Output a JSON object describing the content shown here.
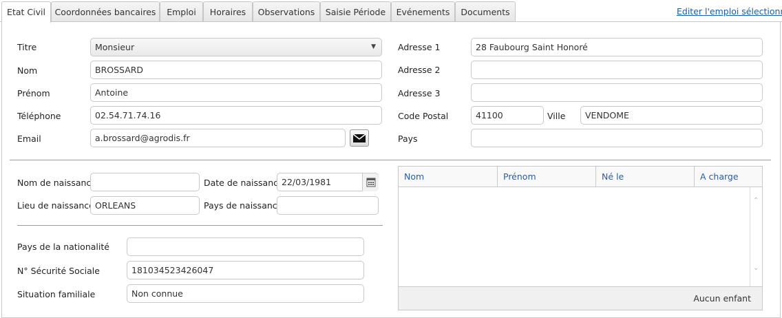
{
  "tabs": [
    {
      "label": "Etat Civil",
      "active": true
    },
    {
      "label": "Coordonnées bancaires",
      "active": false
    },
    {
      "label": "Emploi",
      "active": false
    },
    {
      "label": "Horaires",
      "active": false
    },
    {
      "label": "Observations",
      "active": false
    },
    {
      "label": "Saisie Période",
      "active": false
    },
    {
      "label": "Evénements",
      "active": false
    },
    {
      "label": "Documents",
      "active": false
    }
  ],
  "edit_link": "Editer l'emploi sélectionné",
  "identity": {
    "titre_label": "Titre",
    "titre_value": "Monsieur",
    "nom_label": "Nom",
    "nom_value": "BROSSARD",
    "prenom_label": "Prénom",
    "prenom_value": "Antoine",
    "telephone_label": "Téléphone",
    "telephone_value": "02.54.71.74.16",
    "email_label": "Email",
    "email_value": "a.brossard@agrodis.fr"
  },
  "address": {
    "adresse1_label": "Adresse 1",
    "adresse1_value": "28 Faubourg Saint Honoré",
    "adresse2_label": "Adresse 2",
    "adresse2_value": "",
    "adresse3_label": "Adresse 3",
    "adresse3_value": "",
    "code_postal_label": "Code Postal",
    "code_postal_value": "41100",
    "ville_label": "Ville",
    "ville_value": "VENDOME",
    "pays_label": "Pays",
    "pays_value": ""
  },
  "birth": {
    "nom_naissance_label": "Nom de naissance",
    "nom_naissance_value": "",
    "date_naissance_label": "Date de naissance",
    "date_naissance_value": "22/03/1981",
    "lieu_naissance_label": "Lieu de naissance",
    "lieu_naissance_value": "ORLEANS",
    "pays_naissance_label": "Pays de naissance",
    "pays_naissance_value": ""
  },
  "other": {
    "nationalite_label": "Pays de la nationalité",
    "nationalite_value": "",
    "secu_label": "N° Sécurité Sociale",
    "secu_value": "181034523426047",
    "situation_label": "Situation familiale",
    "situation_value": "Non connue"
  },
  "children_grid": {
    "columns": [
      "Nom",
      "Prénom",
      "Né le",
      "A charge"
    ],
    "rows": [],
    "footer": "Aucun enfant"
  },
  "icons": {
    "dropdown": "chevron-down-icon",
    "mail": "envelope-icon",
    "calendar": "calendar-icon",
    "scroll_up": "scroll-up-icon",
    "scroll_down": "scroll-down-icon"
  },
  "colors": {
    "link": "#1a5ea8",
    "grid_header_text": "#2b5c9e"
  }
}
